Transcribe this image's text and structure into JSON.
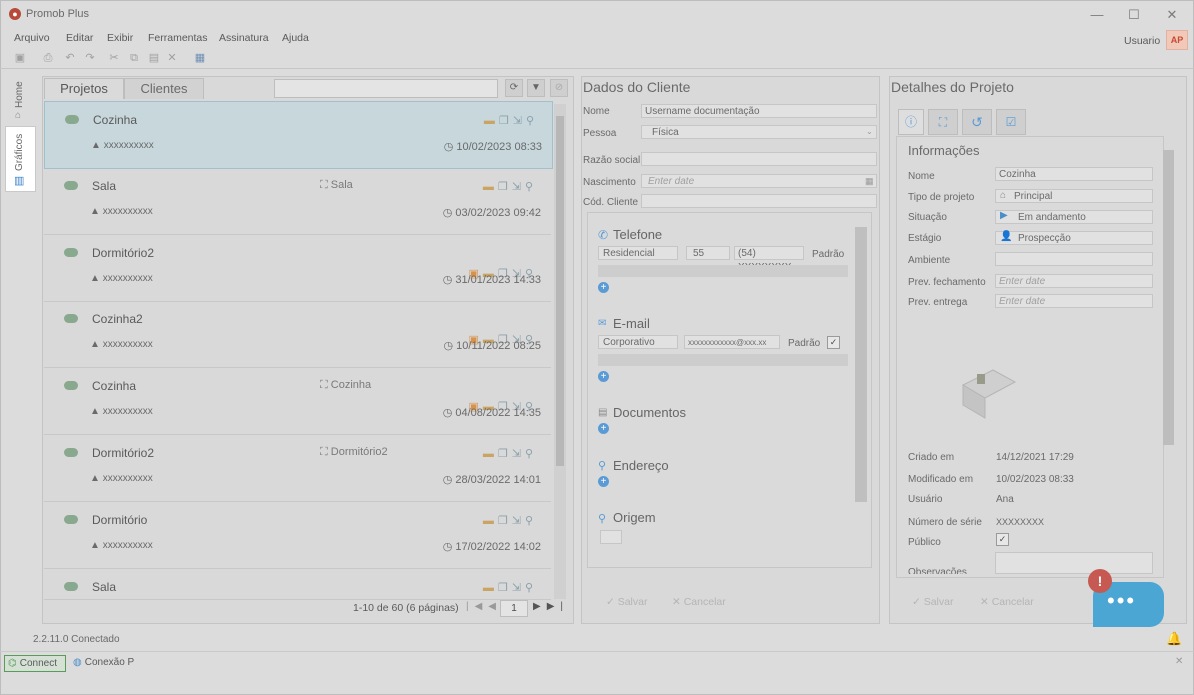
{
  "window": {
    "title": "Promob Plus",
    "minimize": "—",
    "maximize": "☐",
    "close": "✕"
  },
  "menu": [
    "Arquivo",
    "Editar",
    "Exibir",
    "Ferramentas",
    "Assinatura",
    "Ajuda"
  ],
  "user": {
    "label": "Usuario",
    "avatar": "AP"
  },
  "left_tabs": [
    "Home",
    "Gráficos"
  ],
  "projects": {
    "tabs": [
      "Projetos",
      "Clientes"
    ],
    "rows": [
      {
        "title": "Cozinha",
        "owner": "xxxxxxxxxx",
        "env": "",
        "date": "10/02/2023 08:33",
        "selected": true,
        "has_person": false
      },
      {
        "title": "Sala",
        "owner": "xxxxxxxxxx",
        "env": "Sala",
        "date": "03/02/2023 09:42",
        "selected": false,
        "has_person": false
      },
      {
        "title": "Dormitório2",
        "owner": "xxxxxxxxxx",
        "env": "",
        "date": "31/01/2023 14:33",
        "selected": false,
        "has_person": true
      },
      {
        "title": "Cozinha2",
        "owner": "xxxxxxxxxx",
        "env": "",
        "date": "10/11/2022 08:25",
        "selected": false,
        "has_person": true
      },
      {
        "title": "Cozinha",
        "owner": "xxxxxxxxxx",
        "env": "Cozinha",
        "date": "04/08/2022 14:35",
        "selected": false,
        "has_person": true
      },
      {
        "title": "Dormitório2",
        "owner": "xxxxxxxxxx",
        "env": "Dormitório2",
        "date": "28/03/2022 14:01",
        "selected": false,
        "has_person": false
      },
      {
        "title": "Dormitório",
        "owner": "xxxxxxxxxx",
        "env": "",
        "date": "17/02/2022 14:02",
        "selected": false,
        "has_person": false
      },
      {
        "title": "Sala",
        "owner": "",
        "env": "",
        "date": "",
        "selected": false,
        "has_person": false
      }
    ],
    "pager": {
      "summary": "1-10 de 60 (6 páginas)",
      "page": "1"
    }
  },
  "client": {
    "title": "Dados do Cliente",
    "fields": {
      "nome_label": "Nome",
      "nome_value": "Username documentação",
      "pessoa_label": "Pessoa",
      "pessoa_value": "Física",
      "razao_label": "Razão social",
      "nascimento_label": "Nascimento",
      "nascimento_placeholder": "Enter date",
      "codigo_label": "Cód. Cliente"
    },
    "telefone": {
      "title": "Telefone",
      "type": "Residencial",
      "ddi": "55",
      "number": "(54) XXXXXXXX",
      "padrao": "Padrão"
    },
    "email": {
      "title": "E-mail",
      "type": "Corporativo",
      "address": "xxxxxxxxxxxx@xxx.xx",
      "padrao": "Padrão"
    },
    "documentos": "Documentos",
    "endereco": "Endereço",
    "origem": "Origem",
    "save": "Salvar",
    "cancel": "Cancelar"
  },
  "details": {
    "title": "Detalhes do Projeto",
    "info_title": "Informações",
    "labels": {
      "nome": "Nome",
      "tipo": "Tipo de projeto",
      "situacao": "Situação",
      "estagio": "Estágio",
      "ambiente": "Ambiente",
      "prev_fech": "Prev. fechamento",
      "prev_ent": "Prev. entrega",
      "criado": "Criado em",
      "modificado": "Modificado em",
      "usuario": "Usuário",
      "serie": "Número de série",
      "publico": "Público",
      "obs": "Observações"
    },
    "values": {
      "nome": "Cozinha",
      "tipo": "Principal",
      "situacao": "Em andamento",
      "estagio": "Prospecção",
      "prev_fech_ph": "Enter date",
      "prev_ent_ph": "Enter date",
      "criado": "14/12/2021 17:29",
      "modificado": "10/02/2023 08:33",
      "usuario": "Ana",
      "serie": "XXXXXXXX"
    },
    "save": "Salvar",
    "cancel": "Cancelar"
  },
  "status": {
    "text": "2.2.11.0 Conectado"
  },
  "bottom_tabs": [
    "Connect",
    "Conexão P"
  ],
  "chat": {
    "alert": "!",
    "dots": "•••"
  }
}
